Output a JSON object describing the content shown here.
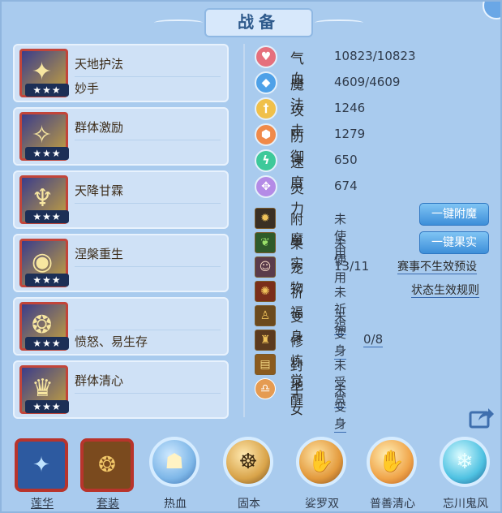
{
  "title": "战备",
  "skills": [
    {
      "name": "天地护法",
      "sub": "妙手",
      "stars": "★★★"
    },
    {
      "name": "群体激励",
      "sub": "",
      "stars": "★★★"
    },
    {
      "name": "天降甘霖",
      "sub": "",
      "stars": "★★★"
    },
    {
      "name": "涅槃重生",
      "sub": "",
      "stars": "★★★"
    },
    {
      "name": "",
      "sub": "愤怒、易生存",
      "stars": "★★★"
    },
    {
      "name": "群体清心",
      "sub": "",
      "stars": "★★★"
    }
  ],
  "stats": [
    {
      "label": "气血",
      "value": "10823/10823",
      "icon": "heart-icon",
      "color": "#e5707d"
    },
    {
      "label": "魔法",
      "value": "4609/4609",
      "icon": "mana-icon",
      "color": "#4ea1e8"
    },
    {
      "label": "攻击",
      "value": "1246",
      "icon": "sword-icon",
      "color": "#f0c04a"
    },
    {
      "label": "防御",
      "value": "1279",
      "icon": "shield-icon",
      "color": "#f08a4a"
    },
    {
      "label": "速度",
      "value": "650",
      "icon": "speed-icon",
      "color": "#3ec99a"
    },
    {
      "label": "灵力",
      "value": "674",
      "icon": "spirit-icon",
      "color": "#b48be6"
    }
  ],
  "items": [
    {
      "label": "附魔",
      "value": "未使用",
      "icon": "enchant-icon"
    },
    {
      "label": "果实",
      "value": "未使用",
      "icon": "fruit-icon"
    },
    {
      "label": "宠物",
      "value": "13/11",
      "icon": "pet-icon"
    },
    {
      "label": "祈福",
      "value": "未祈福",
      "icon": "pray-icon"
    },
    {
      "label": "变身",
      "value": "未变身",
      "icon": "transform-icon"
    },
    {
      "label": "修炼觉醒",
      "value": "0/8",
      "icon": "cultivate-icon"
    },
    {
      "label": "封地",
      "value": "未受赏",
      "icon": "fief-icon"
    },
    {
      "label": "子女",
      "value": "未变身",
      "icon": "child-icon"
    }
  ],
  "buttons": {
    "enchant": "一键附魔",
    "fruit": "一键果实"
  },
  "links": {
    "tournament": "赛事不生效预设",
    "status_rules": "状态生效规则"
  },
  "bottom": [
    {
      "label": "莲华",
      "icon": "lotus-icon",
      "glyph": "✦"
    },
    {
      "label": "套装",
      "icon": "armor-set-icon",
      "glyph": "❂"
    },
    {
      "label": "热血",
      "icon": "hotblood-icon",
      "glyph": "☗"
    },
    {
      "label": "固本",
      "icon": "guben-icon",
      "glyph": "☸"
    },
    {
      "label": "娑罗双",
      "icon": "suoluo-icon",
      "glyph": "✋"
    },
    {
      "label": "普善清心",
      "icon": "pushan-icon",
      "glyph": "✋"
    },
    {
      "label": "忘川鬼风",
      "icon": "wangchuan-icon",
      "glyph": "❄"
    }
  ]
}
